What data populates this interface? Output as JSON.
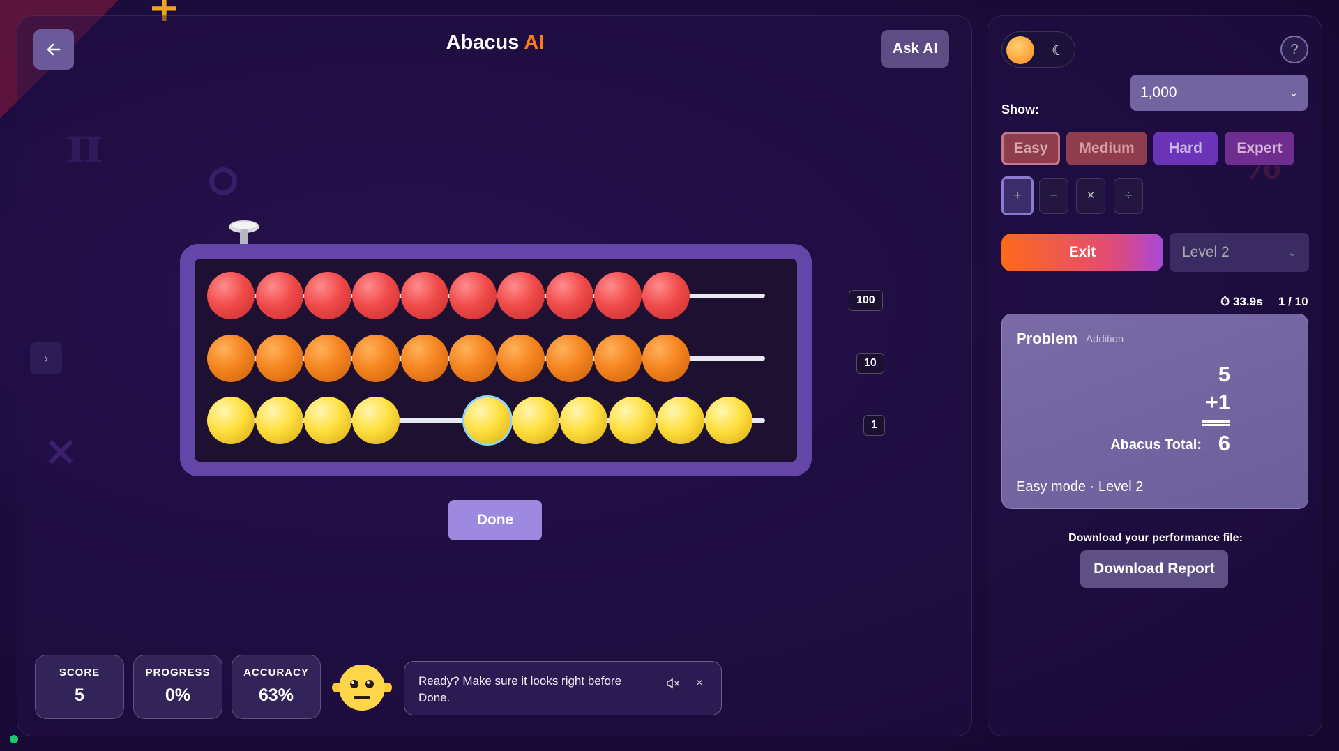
{
  "app": {
    "title_main": "Abacus ",
    "title_accent": "AI"
  },
  "header": {
    "ask_ai_label": "Ask AI"
  },
  "abacus": {
    "place_values": [
      "100",
      "10",
      "1"
    ],
    "bead_colors": {
      "hundreds": "#f14a4a",
      "tens": "#f5841f",
      "ones": "#ffdf3e"
    },
    "frame_color": "#6446a8"
  },
  "actions": {
    "done_label": "Done"
  },
  "stats": [
    {
      "label": "SCORE",
      "value": "5"
    },
    {
      "label": "PROGRESS",
      "value": "0%"
    },
    {
      "label": "ACCURACY",
      "value": "63%"
    }
  ],
  "assistant": {
    "message": "Ready? Make sure it looks right before Done."
  },
  "controls": {
    "show_label": "Show:",
    "show_value": "1,000",
    "difficulties": [
      "Easy",
      "Medium",
      "Hard",
      "Expert"
    ],
    "operations": [
      "+",
      "−",
      "×",
      "÷"
    ],
    "exit_label": "Exit",
    "level_value": "Level 2",
    "timer": "33.9s",
    "counter": "1 / 10"
  },
  "problem": {
    "title": "Problem",
    "operation": "Addition",
    "operand1": "5",
    "operand2": "+1",
    "total_label": "Abacus Total:",
    "total_value": "6",
    "mode_text": "Easy mode · Level 2"
  },
  "report": {
    "label": "Download your performance file:",
    "button": "Download Report"
  },
  "colors": {
    "accent": "#ff7a1a",
    "background": "#1c0c3e",
    "status_online": "#1ec76f"
  },
  "icons": [
    "back-arrow-icon",
    "chevron-right-icon",
    "sun-icon",
    "moon-icon",
    "help-icon",
    "timer-icon",
    "mute-icon",
    "close-icon",
    "chevron-down-icon"
  ]
}
